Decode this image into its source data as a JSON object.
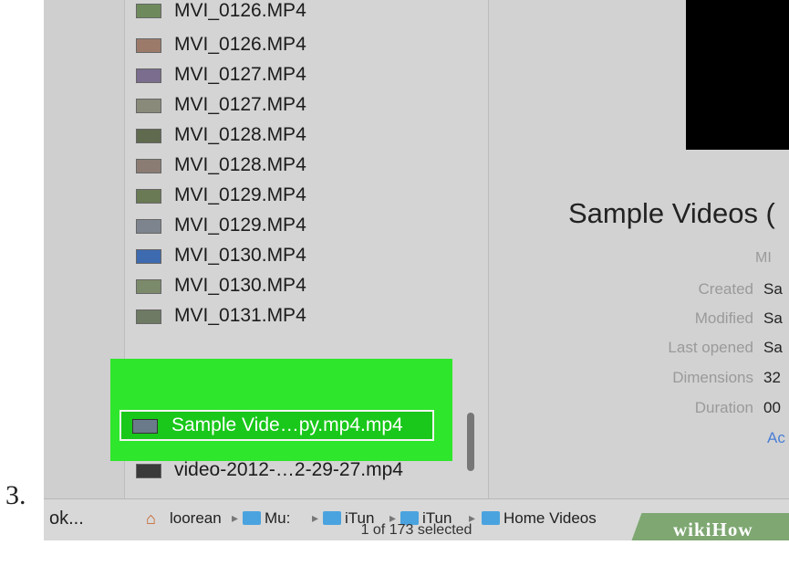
{
  "step_number": "3.",
  "file_list": [
    {
      "name": "MVI_0126.MP4",
      "thumb_color": "#6e8a5c"
    },
    {
      "name": "MVI_0126.MP4",
      "thumb_color": "#9c7a6a"
    },
    {
      "name": "MVI_0127.MP4",
      "thumb_color": "#7a6d8d"
    },
    {
      "name": "MVI_0127.MP4",
      "thumb_color": "#8a8a7a"
    },
    {
      "name": "MVI_0128.MP4",
      "thumb_color": "#5f6a4e"
    },
    {
      "name": "MVI_0128.MP4",
      "thumb_color": "#8b7c73"
    },
    {
      "name": "MVI_0129.MP4",
      "thumb_color": "#6a7a55"
    },
    {
      "name": "MVI_0129.MP4",
      "thumb_color": "#7d848e"
    },
    {
      "name": "MVI_0130.MP4",
      "thumb_color": "#3e6ab0"
    },
    {
      "name": "MVI_0130.MP4",
      "thumb_color": "#7b8a6a"
    },
    {
      "name": "MVI_0131.MP4",
      "thumb_color": "#6e7a63"
    }
  ],
  "selected_file": "Sample Vide…py.mp4.mp4",
  "last_file": "video-2012-…2-29-27.mp4",
  "preview": {
    "title": "Sample Videos (",
    "kind": "MI",
    "info": [
      {
        "key": "Created",
        "value": "Sa"
      },
      {
        "key": "Modified",
        "value": "Sa"
      },
      {
        "key": "Last opened",
        "value": "Sa"
      },
      {
        "key": "Dimensions",
        "value": "32"
      },
      {
        "key": "Duration",
        "value": "00"
      }
    ],
    "add_tags": "Ac"
  },
  "sidebar_label": "ok...",
  "path_bar": [
    "loorean",
    "Mu:",
    "iTun",
    "iTun",
    "Home Videos"
  ],
  "status_text": "1 of 173 selected",
  "watermark": "wikiHow",
  "colors": {
    "highlight": "#2ee62b",
    "folder": "#4aa3de"
  }
}
